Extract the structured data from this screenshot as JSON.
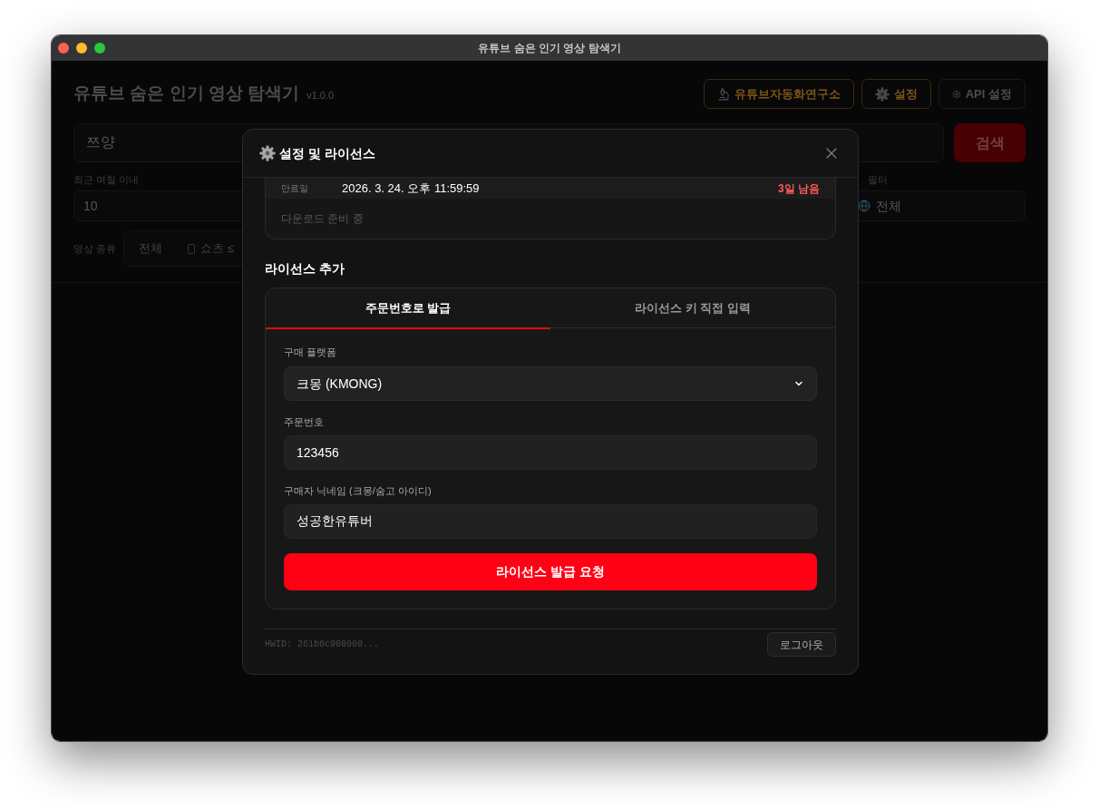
{
  "window": {
    "title": "유튜브 숨은 인기 영상 탐색기"
  },
  "app": {
    "header": {
      "title": "유튜브 숨은 인기 영상 탐색기",
      "version": "v1.0.0",
      "buttons": [
        {
          "kind": "lab",
          "label": "유튜브자동화연구소"
        },
        {
          "kind": "settings",
          "label": "설정"
        },
        {
          "kind": "api",
          "label": "API 설정"
        }
      ]
    },
    "search": {
      "value": "쯔양",
      "button": "검색"
    },
    "filters": [
      {
        "kind": "input",
        "label": "최근 며칠 이내",
        "value": "10"
      },
      {
        "kind": "select",
        "label": "필터",
        "value": "전체"
      }
    ],
    "video_type": {
      "label": "영상 종류",
      "options": [
        {
          "kind": "all",
          "label": "전체"
        },
        {
          "kind": "shorts",
          "label": "쇼츠 ≤"
        }
      ]
    }
  },
  "dialog": {
    "title": "설정 및 라이선스",
    "license": {
      "expiry_label": "만료일",
      "expiry": "2026. 3. 24. 오후 11:59:59",
      "remaining": "3일 남음",
      "status": "다운로드 준비 중"
    },
    "add_license": {
      "heading": "라이선스 추가",
      "tabs": [
        {
          "label": "주문번호로 발급",
          "selected": true
        },
        {
          "label": "라이선스 키 직접 입력",
          "selected": false
        }
      ],
      "fields": [
        {
          "kind": "select",
          "label": "구매 플랫폼",
          "value": "크몽 (KMONG)"
        },
        {
          "kind": "input",
          "label": "주문번호",
          "value": "123456"
        },
        {
          "kind": "input",
          "label": "구매자 닉네임 (크몽/숨고 아이디)",
          "value": "성공한유튜버"
        }
      ],
      "submit": "라이선스 발급 요청"
    },
    "footer": {
      "hwid": "HWID: 261b6c908009...",
      "logout": "로그아웃"
    }
  }
}
